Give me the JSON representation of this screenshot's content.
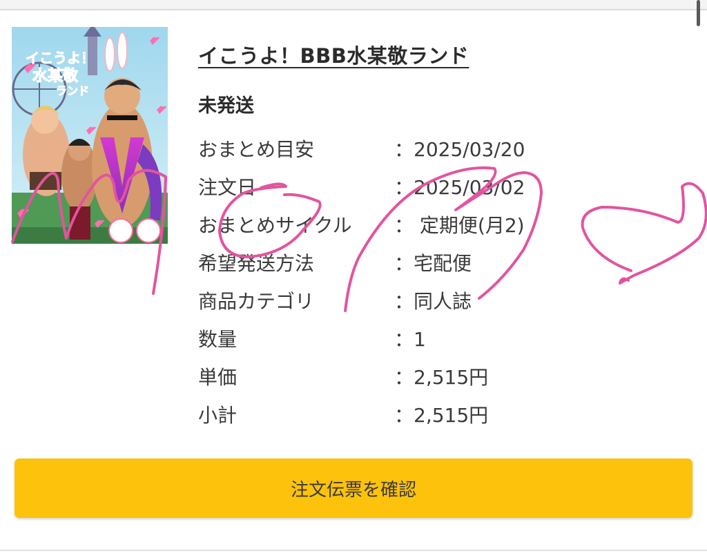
{
  "product": {
    "title": "イこうよ！BBB水某敬ランド",
    "status": "未発送",
    "details": [
      {
        "label": "おまとめ目安",
        "value": "：2025/03/20"
      },
      {
        "label": "注文日",
        "value": "：2025/03/02"
      },
      {
        "label": "おまとめサイクル",
        "value": "：  定期便(月2)"
      },
      {
        "label": "希望発送方法",
        "value": "：宅配便"
      },
      {
        "label": "商品カテゴリ",
        "value": "：同人誌"
      },
      {
        "label": "数量",
        "value": "：1"
      },
      {
        "label": "単価",
        "value": "：2,515円"
      },
      {
        "label": "小計",
        "value": "：2,515円"
      }
    ]
  },
  "actions": {
    "confirm_label": "注文伝票を確認"
  },
  "colors": {
    "button": "#fdc20b",
    "scribble": "#e2549e"
  }
}
